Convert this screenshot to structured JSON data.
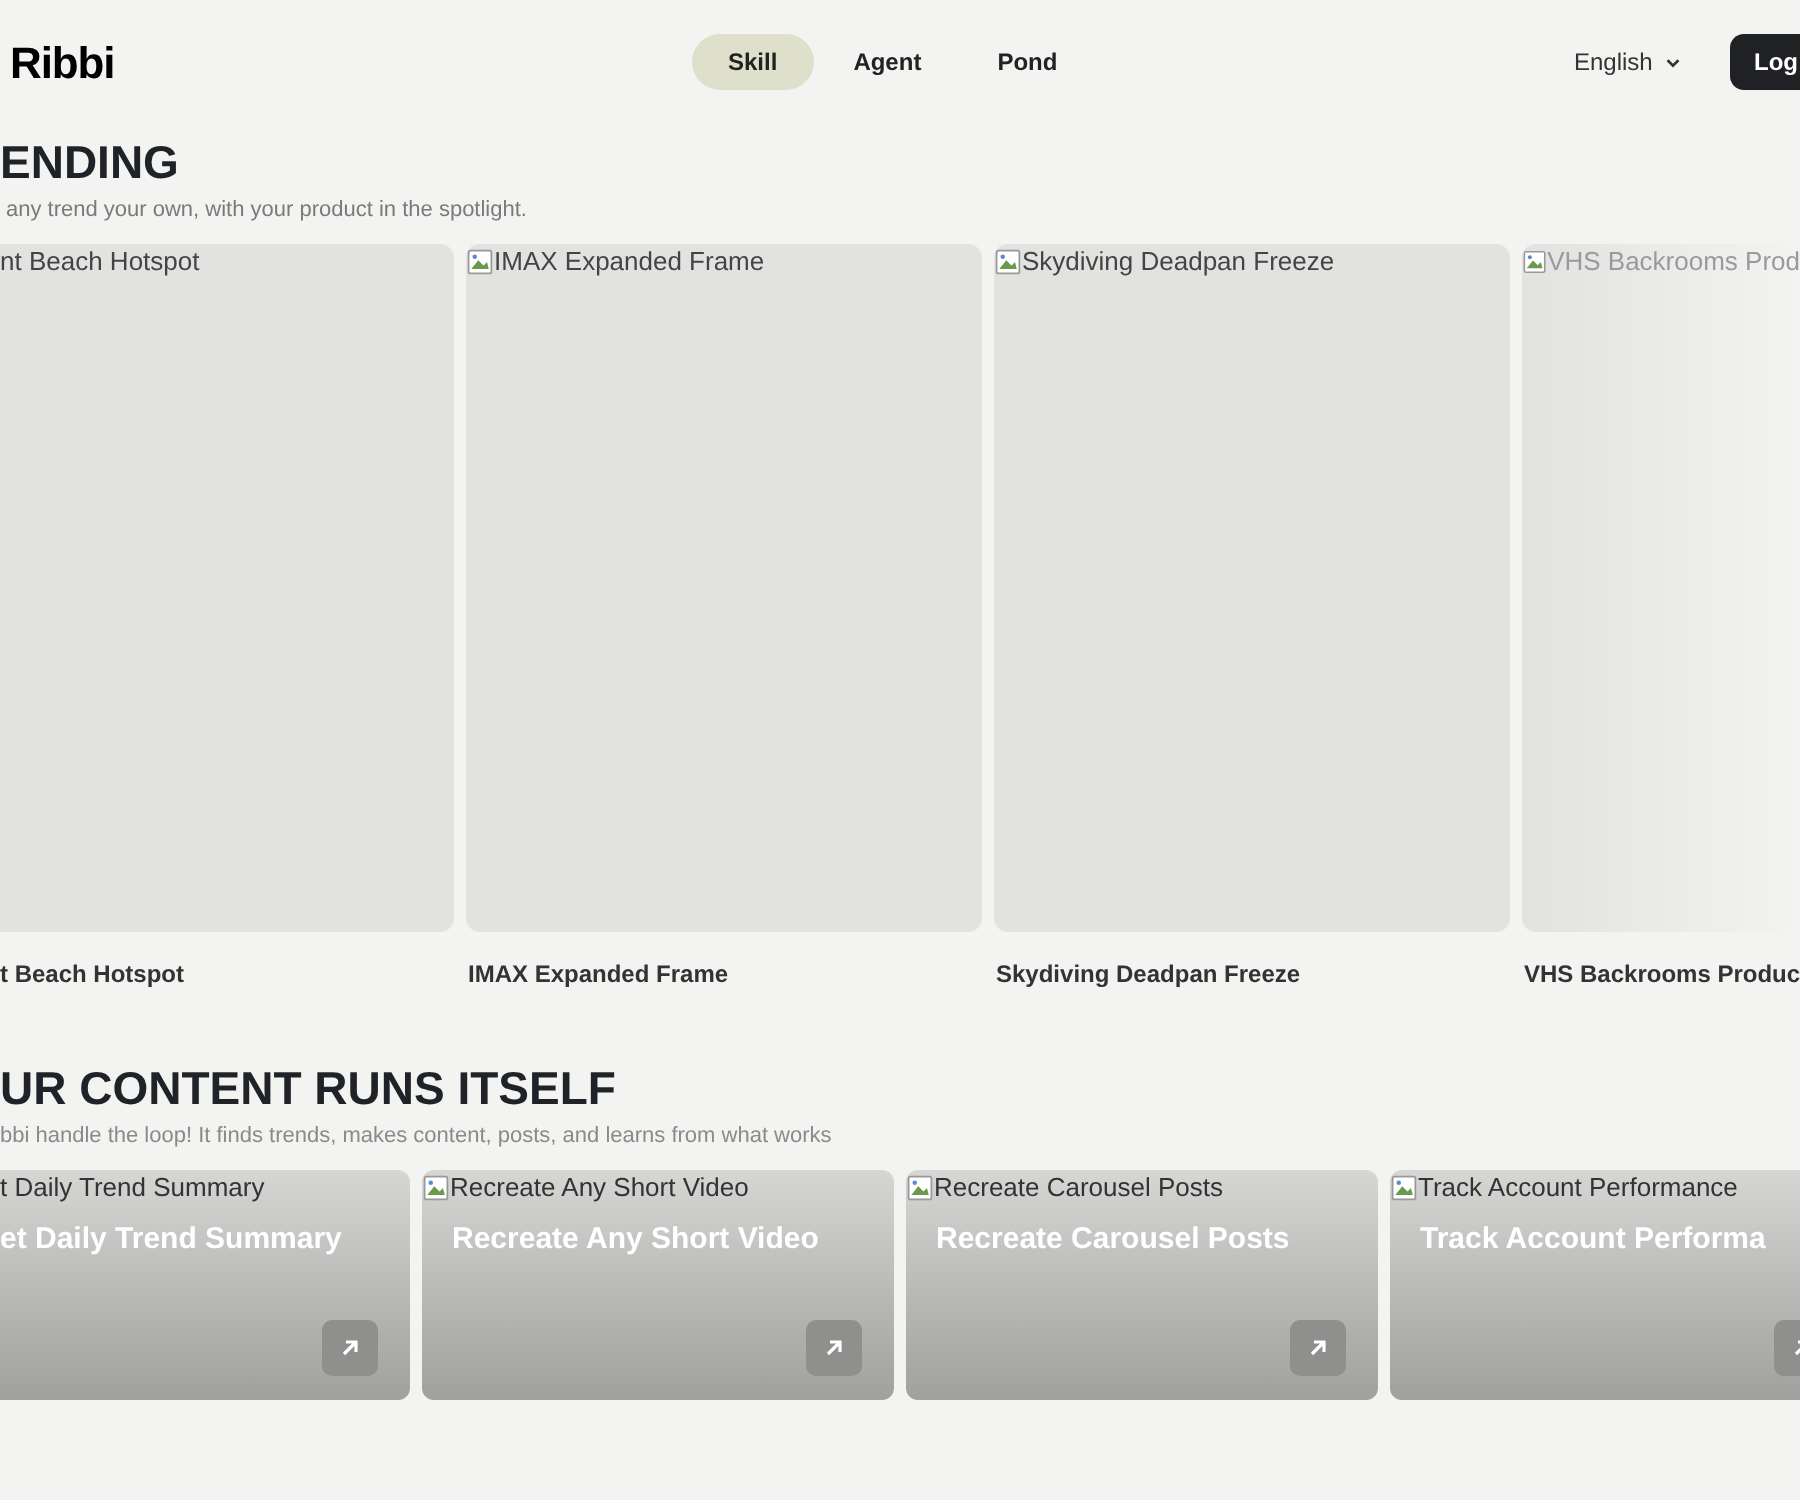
{
  "nav": {
    "logo": "Ribbi",
    "tabs": [
      {
        "label": "Skill",
        "selected": true
      },
      {
        "label": "Agent",
        "selected": false
      },
      {
        "label": "Pond",
        "selected": false
      }
    ],
    "language": "English",
    "login": "Log"
  },
  "trending": {
    "title": "ENDING",
    "subtitle": "any trend your own, with your product in the spotlight.",
    "cards": [
      {
        "alt": "nt Beach Hotspot",
        "title": "t Beach Hotspot",
        "image_icon": false,
        "faded": false
      },
      {
        "alt": "IMAX Expanded Frame",
        "title": "IMAX Expanded Frame",
        "image_icon": true,
        "faded": false
      },
      {
        "alt": "Skydiving Deadpan Freeze",
        "title": "Skydiving Deadpan Freeze",
        "image_icon": true,
        "faded": false
      },
      {
        "alt": "VHS Backrooms Prod",
        "title": "VHS Backrooms Produc",
        "image_icon": true,
        "faded": true
      }
    ]
  },
  "loop": {
    "title": "UR CONTENT RUNS ITSELF",
    "subtitle": "bbi handle the loop! It finds trends, makes content, posts, and learns from what works",
    "cards": [
      {
        "alt": "t Daily Trend Summary",
        "title": "et Daily Trend Summary",
        "image_icon": false
      },
      {
        "alt": "Recreate Any Short Video",
        "title": "Recreate Any Short Video",
        "image_icon": true
      },
      {
        "alt": "Recreate Carousel Posts",
        "title": "Recreate Carousel Posts",
        "image_icon": true
      },
      {
        "alt": "Track Account Performance",
        "title": "Track Account Performa",
        "image_icon": true
      }
    ]
  }
}
